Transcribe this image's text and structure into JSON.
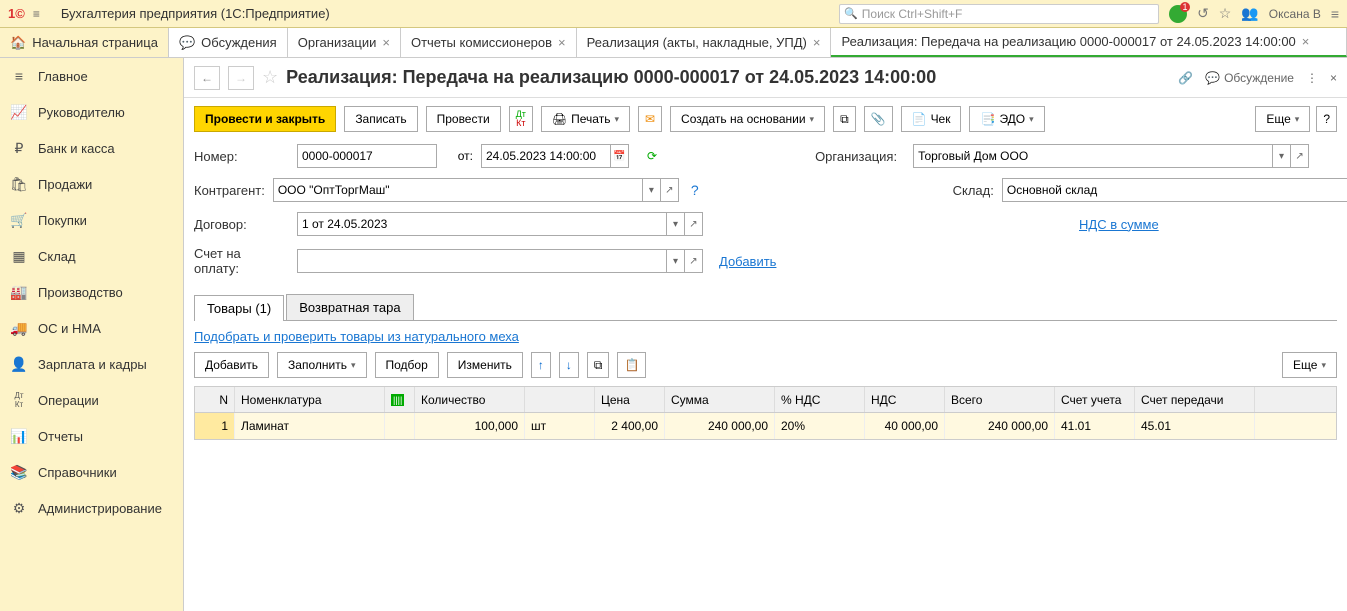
{
  "app": {
    "title": "Бухгалтерия предприятия  (1С:Предприятие)",
    "search_placeholder": "Поиск Ctrl+Shift+F",
    "user": "Оксана В"
  },
  "tabs": {
    "home": "Начальная страница",
    "list": [
      "Обсуждения",
      "Организации",
      "Отчеты комиссионеров",
      "Реализация (акты, накладные, УПД)"
    ],
    "active": "Реализация: Передача на реализацию 0000-000017 от 24.05.2023 14:00:00"
  },
  "sidebar": [
    {
      "icon": "≡",
      "label": "Главное"
    },
    {
      "icon": "📈",
      "label": "Руководителю"
    },
    {
      "icon": "₽",
      "label": "Банк и касса"
    },
    {
      "icon": "🛍",
      "label": "Продажи"
    },
    {
      "icon": "🛒",
      "label": "Покупки"
    },
    {
      "icon": "▦",
      "label": "Склад"
    },
    {
      "icon": "🏭",
      "label": "Производство"
    },
    {
      "icon": "🚚",
      "label": "ОС и НМА"
    },
    {
      "icon": "👤",
      "label": "Зарплата и кадры"
    },
    {
      "icon": "Дт Кт",
      "label": "Операции"
    },
    {
      "icon": "📊",
      "label": "Отчеты"
    },
    {
      "icon": "📚",
      "label": "Справочники"
    },
    {
      "icon": "⚙",
      "label": "Администрирование"
    }
  ],
  "page": {
    "title": "Реализация: Передача на реализацию 0000-000017 от 24.05.2023 14:00:00",
    "discussion": "Обсуждение"
  },
  "toolbar": {
    "post_close": "Провести и закрыть",
    "save": "Записать",
    "post": "Провести",
    "print": "Печать",
    "create_based": "Создать на основании",
    "check": "Чек",
    "edo": "ЭДО",
    "more": "Еще"
  },
  "form": {
    "number_label": "Номер:",
    "number": "0000-000017",
    "date_label": "от:",
    "date": "24.05.2023 14:00:00",
    "org_label": "Организация:",
    "org": "Торговый Дом ООО",
    "counterparty_label": "Контрагент:",
    "counterparty": "ООО \"ОптТоргМаш\"",
    "warehouse_label": "Склад:",
    "warehouse": "Основной склад",
    "contract_label": "Договор:",
    "contract": "1 от 24.05.2023",
    "vat_link": "НДС в сумме",
    "invoice_label": "Счет на оплату:",
    "invoice": "",
    "add_link": "Добавить"
  },
  "subtabs": {
    "goods": "Товары (1)",
    "tare": "Возвратная тара"
  },
  "fur_link": "Подобрать и проверить товары из натурального меха",
  "table_toolbar": {
    "add": "Добавить",
    "fill": "Заполнить",
    "select": "Подбор",
    "edit": "Изменить",
    "more": "Еще"
  },
  "grid": {
    "headers": {
      "n": "N",
      "nomenclature": "Номенклатура",
      "qty": "Количество",
      "price": "Цена",
      "sum": "Сумма",
      "vat_pct": "% НДС",
      "vat": "НДС",
      "total": "Всего",
      "acc": "Счет учета",
      "acc_transfer": "Счет передачи"
    },
    "rows": [
      {
        "n": "1",
        "nomenclature": "Ламинат",
        "qty": "100,000",
        "unit": "шт",
        "price": "2 400,00",
        "sum": "240 000,00",
        "vat_pct": "20%",
        "vat": "40 000,00",
        "total": "240 000,00",
        "acc": "41.01",
        "acc_transfer": "45.01"
      }
    ]
  }
}
